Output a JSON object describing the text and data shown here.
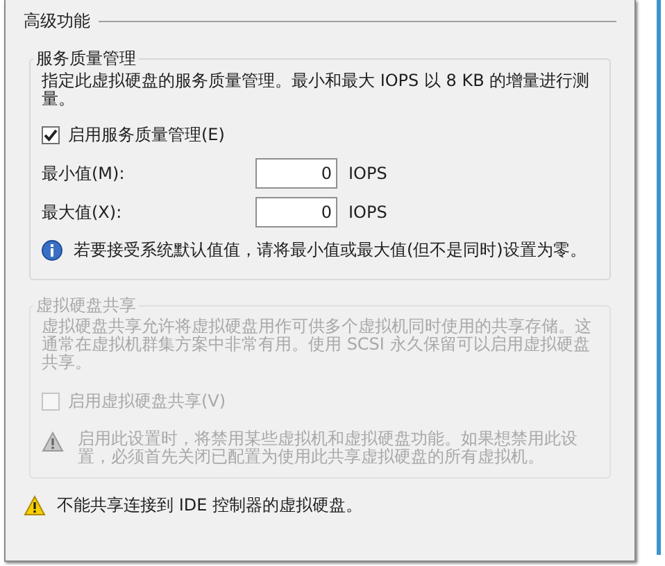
{
  "section_title": "高级功能",
  "qos": {
    "title": "服务质量管理",
    "description": "指定此虚拟硬盘的服务质量管理。最小和最大 IOPS 以 8 KB 的增量进行测量。",
    "enable": {
      "label": "启用服务质量管理(E)",
      "checked": true
    },
    "fields": [
      {
        "label": "最小值(M):",
        "value": "0",
        "unit": "IOPS"
      },
      {
        "label": "最大值(X):",
        "value": "0",
        "unit": "IOPS"
      }
    ],
    "info": "若要接受系统默认值值，请将最小值或最大值(但不是同时)设置为零。"
  },
  "sharing": {
    "title": "虚拟硬盘共享",
    "disabled": true,
    "description": "虚拟硬盘共享允许将虚拟硬盘用作可供多个虚拟机同时使用的共享存储。这通常在虚拟机群集方案中非常有用。使用 SCSI 永久保留可以启用虚拟硬盘共享。",
    "enable": {
      "label": "启用虚拟硬盘共享(V)",
      "checked": false
    },
    "warning": "启用此设置时，将禁用某些虚拟机和虚拟硬盘功能。如果想禁用此设置，必须首先关闭已配置为使用此共享虚拟硬盘的所有虚拟机。"
  },
  "footer_warning": "不能共享连接到 IDE 控制器的虚拟硬盘。"
}
